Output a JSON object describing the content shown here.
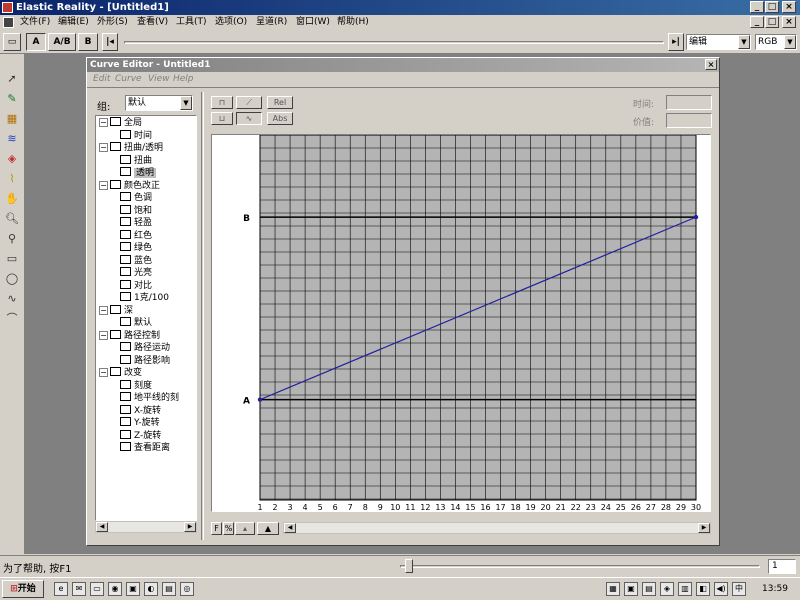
{
  "app": {
    "title": "Elastic Reality - [Untitled1]"
  },
  "menu": [
    "文件(F)",
    "编辑(E)",
    "外形(S)",
    "查看(V)",
    "工具(T)",
    "选项(O)",
    "呈道(R)",
    "窗口(W)",
    "帮助(H)"
  ],
  "toolbar": {
    "btn_a": "A",
    "btn_ab": "A/B",
    "btn_b": "B",
    "mode_select": "编辑",
    "color_select": "RGB"
  },
  "dialog": {
    "title": "Curve Editor - Untitled1",
    "menu": [
      "Edit",
      "Curve",
      "View",
      "Help"
    ],
    "group_label": "组:",
    "group_value": "默认",
    "btn_rel": "Rel",
    "btn_abs": "Abs",
    "time_label": "时间:",
    "value_label": "价值:",
    "tree": [
      {
        "label": "全局",
        "level": 0,
        "expander": "−"
      },
      {
        "label": "时间",
        "level": 1
      },
      {
        "label": "扭曲/透明",
        "level": 0,
        "expander": "−"
      },
      {
        "label": "扭曲",
        "level": 1
      },
      {
        "label": "透明",
        "level": 1,
        "selected": true
      },
      {
        "label": "颜色改正",
        "level": 0,
        "expander": "−"
      },
      {
        "label": "色调",
        "level": 1
      },
      {
        "label": "饱和",
        "level": 1
      },
      {
        "label": "轻盈",
        "level": 1
      },
      {
        "label": "红色",
        "level": 1
      },
      {
        "label": "绿色",
        "level": 1
      },
      {
        "label": "蓝色",
        "level": 1
      },
      {
        "label": "光亮",
        "level": 1
      },
      {
        "label": "对比",
        "level": 1
      },
      {
        "label": "1克/100",
        "level": 1
      },
      {
        "label": "深",
        "level": 0,
        "expander": "−"
      },
      {
        "label": "默认",
        "level": 1
      },
      {
        "label": "路径控制",
        "level": 0,
        "expander": "−"
      },
      {
        "label": "路径运动",
        "level": 1
      },
      {
        "label": "路径影响",
        "level": 1
      },
      {
        "label": "改变",
        "level": 0,
        "expander": "−"
      },
      {
        "label": "刻度",
        "level": 1
      },
      {
        "label": "地平线的刻",
        "level": 1
      },
      {
        "label": "X-旋转",
        "level": 1
      },
      {
        "label": "Y-旋转",
        "level": 1
      },
      {
        "label": "Z-旋转",
        "level": 1
      },
      {
        "label": "查看距离",
        "level": 1
      }
    ],
    "bottom_btn_f": "F"
  },
  "chart_data": {
    "type": "line",
    "x_ticks": [
      1,
      2,
      3,
      4,
      5,
      6,
      7,
      8,
      9,
      10,
      11,
      12,
      13,
      14,
      15,
      16,
      17,
      18,
      19,
      20,
      21,
      22,
      23,
      24,
      25,
      26,
      27,
      28,
      29,
      30
    ],
    "xlim": [
      1,
      30
    ],
    "ylim": [
      -0.55,
      1.45
    ],
    "ref_lines": [
      {
        "label": "A",
        "value": 0
      },
      {
        "label": "B",
        "value": 1
      }
    ],
    "series": [
      {
        "x": [
          1,
          30
        ],
        "y": [
          0,
          1
        ],
        "color": "#2020a0"
      }
    ],
    "grid": true,
    "grid_color": "#000000",
    "plot_bg": "#b4b4b4"
  },
  "status": {
    "help_text": "为了帮助, 按F1",
    "frame_value": "1"
  },
  "taskbar": {
    "start_label": "开始",
    "clock": "13:59"
  }
}
